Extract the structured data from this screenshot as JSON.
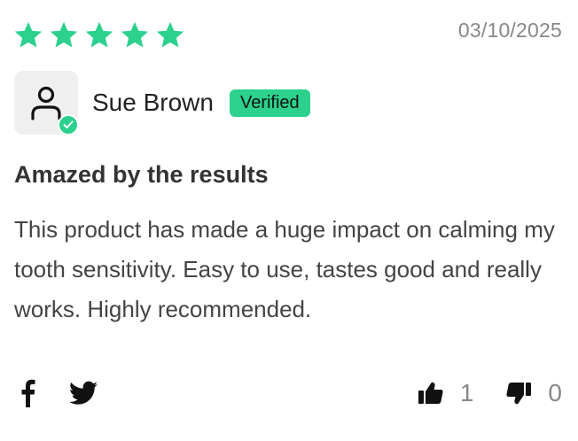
{
  "review": {
    "rating": 5,
    "max_rating": 5,
    "date": "03/10/2025",
    "reviewer_name": "Sue Brown",
    "verified_label": "Verified",
    "title": "Amazed by the results",
    "body": "This product has made a huge impact on calming my tooth sensitivity. Easy to use, tastes good and really works. Highly recommended."
  },
  "social": {
    "icons": [
      "facebook-icon",
      "twitter-icon"
    ]
  },
  "votes": {
    "helpful_count": "1",
    "not_helpful_count": "0"
  },
  "colors": {
    "accent": "#2bd18d",
    "text": "#333333",
    "muted": "#888888",
    "avatar_bg": "#efefef"
  }
}
